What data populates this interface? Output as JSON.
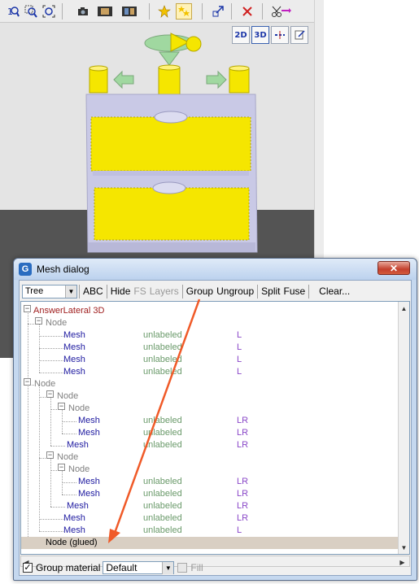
{
  "background_toolbar": {
    "buttons": [
      "zoom-1-icon",
      "zoom-region-icon",
      "zoom-fit-icon",
      "camera-icon",
      "film-icon",
      "film-strip-icon",
      "star-icon",
      "stars-icon",
      "transform-icon",
      "delete-icon",
      "cut-icon"
    ]
  },
  "view_buttons": {
    "b2d": "2D",
    "b3d": "3D"
  },
  "dialog": {
    "title": "Mesh dialog",
    "close_label": "✕",
    "toolbar": {
      "mode": "Tree",
      "abc": "ABC",
      "hide": "Hide",
      "fs": "FS",
      "layers": "Layers",
      "group": "Group",
      "ungroup": "Ungroup",
      "split": "Split",
      "fuse": "Fuse",
      "clear": "Clear..."
    },
    "tree": {
      "root": "AnswerLateral 3D",
      "node": "Node",
      "mesh": "Mesh",
      "unlabeled": "unlabeled",
      "flag_l": "L",
      "flag_lr": "LR",
      "glued": "Node (glued)"
    },
    "footer": {
      "group_material": "Group material",
      "material": "Default",
      "fill": "Fill"
    }
  },
  "colors": {
    "annotation_arrow": "#f05a28",
    "drawer_yellow": "#f5e600",
    "cabinet_lavender": "#c8c8e8"
  }
}
